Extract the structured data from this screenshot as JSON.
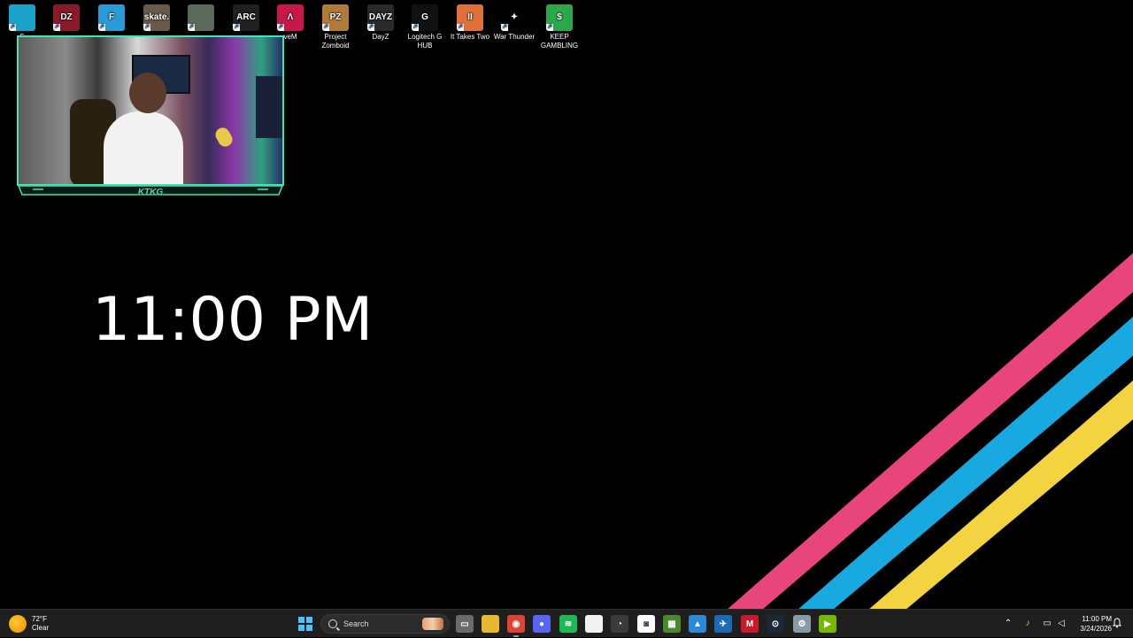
{
  "desktop": {
    "icons": [
      {
        "label": "S",
        "icon": "smiley-icon",
        "color": "#1aa3c9"
      },
      {
        "label": "",
        "icon": "dayz-alt-icon",
        "color": "#8a1a2a",
        "glyph": "DZ"
      },
      {
        "label": "",
        "icon": "fortnite-icon",
        "color": "#2a9ad8",
        "glyph": "F"
      },
      {
        "label": "",
        "icon": "skate-icon",
        "color": "#6a5a4a",
        "glyph": "skate."
      },
      {
        "label": "",
        "icon": "game-cover-icon",
        "color": "#5a6a5a",
        "glyph": ""
      },
      {
        "label": "",
        "icon": "arc-raiders-icon",
        "color": "#202020",
        "glyph": "ARC"
      },
      {
        "label": "veM",
        "icon": "fivem-icon",
        "color": "#c8184a",
        "glyph": "Λ"
      },
      {
        "label": "Project Zomboid",
        "icon": "project-zomboid-icon",
        "color": "#b07a3a",
        "glyph": "PZ"
      },
      {
        "label": "DayZ",
        "icon": "dayz-icon",
        "color": "#2a2a2a",
        "glyph": "DAYZ"
      },
      {
        "label": "Logitech G HUB",
        "icon": "logitech-g-icon",
        "color": "#111111",
        "glyph": "G"
      },
      {
        "label": "It Takes Two",
        "icon": "it-takes-two-icon",
        "color": "#e0703a",
        "glyph": "II"
      },
      {
        "label": "War Thunder",
        "icon": "war-thunder-icon",
        "color": "#000000",
        "glyph": "✦"
      },
      {
        "label": "KEEP GAMBLING",
        "icon": "dollar-icon",
        "color": "#2aa84a",
        "glyph": "$"
      }
    ],
    "clock": "11:00 PM",
    "webcam_logo": "KTKG",
    "stripe_colors": [
      "#e8457d",
      "#17a9e0",
      "#f3d33f"
    ]
  },
  "taskbar": {
    "weather": {
      "temp": "72°F",
      "condition": "Clear",
      "icon": "weather-moon-icon"
    },
    "search_placeholder": "Search",
    "apps": [
      {
        "name": "task-view",
        "icon": "task-view-icon",
        "color": "#6a6a6a",
        "glyph": "▭"
      },
      {
        "name": "file-explorer",
        "icon": "folder-icon",
        "color": "#e8b830",
        "glyph": ""
      },
      {
        "name": "chrome",
        "icon": "chrome-icon",
        "color": "#dd4433",
        "glyph": "◉",
        "active": true
      },
      {
        "name": "discord-ptb",
        "icon": "discord-icon",
        "color": "#5865f2",
        "glyph": "●"
      },
      {
        "name": "spotify",
        "icon": "spotify-icon",
        "color": "#1db954",
        "glyph": "≋"
      },
      {
        "name": "notepad",
        "icon": "document-icon",
        "color": "#f2f2f2",
        "glyph": ""
      },
      {
        "name": "obs",
        "icon": "obs-icon",
        "color": "#3a3a3a",
        "glyph": "◔"
      },
      {
        "name": "discord",
        "icon": "discord-app-icon",
        "color": "#ffffff",
        "glyph": "◙"
      },
      {
        "name": "minecraft",
        "icon": "minecraft-icon",
        "color": "#4a8a2a",
        "glyph": "▦"
      },
      {
        "name": "photos",
        "icon": "photos-icon",
        "color": "#2a8ad8",
        "glyph": "▲"
      },
      {
        "name": "steam-alt",
        "icon": "tidal-icon",
        "color": "#1a6ab8",
        "glyph": "✈"
      },
      {
        "name": "msi",
        "icon": "msi-icon",
        "color": "#c81a2a",
        "glyph": "M"
      },
      {
        "name": "steam",
        "icon": "steam-icon",
        "color": "#1b2838",
        "glyph": "⊙"
      },
      {
        "name": "settings",
        "icon": "gear-icon",
        "color": "#8a9aaa",
        "glyph": "⚙"
      },
      {
        "name": "nvidia",
        "icon": "nvidia-icon",
        "color": "#76b900",
        "glyph": "▶"
      }
    ],
    "tray": {
      "time": "11:00 PM",
      "date": "3/24/2026"
    }
  }
}
